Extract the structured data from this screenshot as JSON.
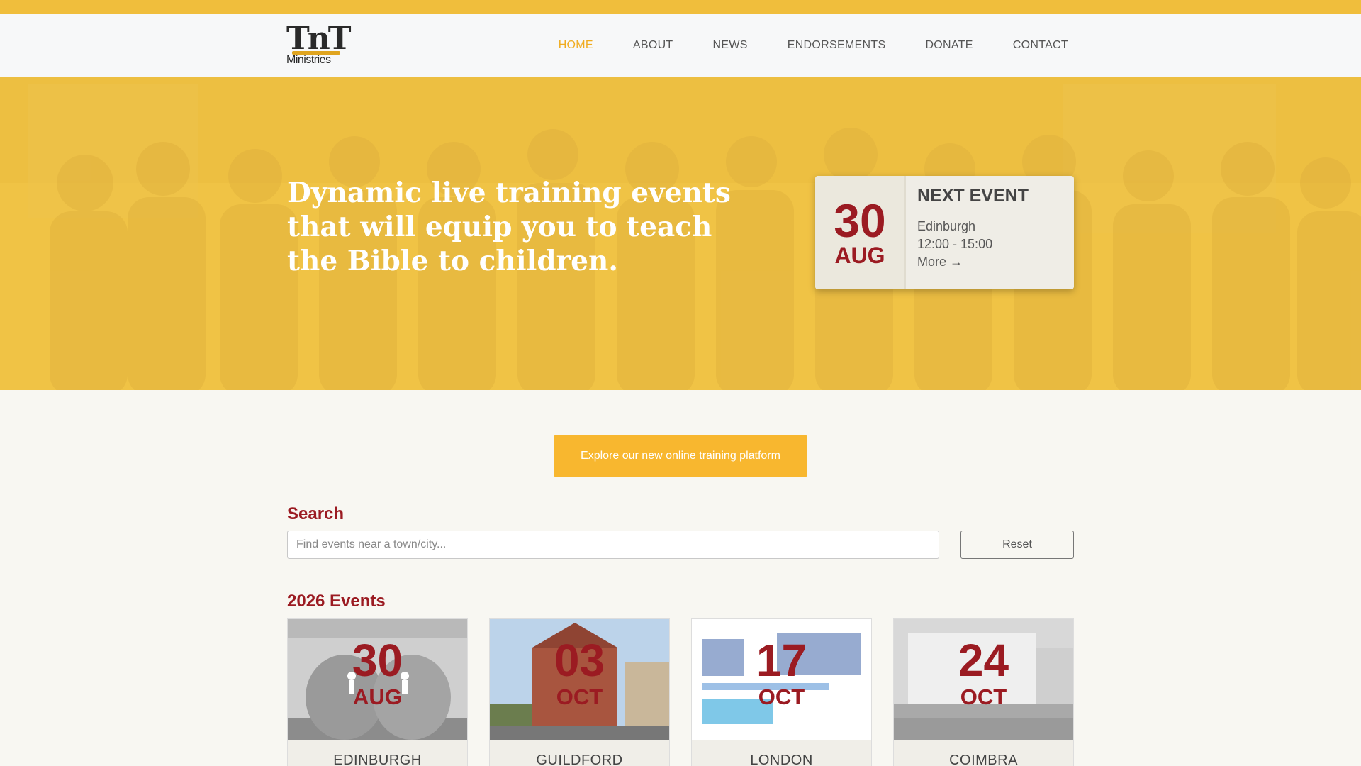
{
  "brand": {
    "logo_top": "TnT",
    "logo_bottom": "Ministries"
  },
  "nav": {
    "items": [
      "HOME",
      "ABOUT",
      "NEWS",
      "ENDORSEMENTS",
      "DONATE",
      "CONTACT"
    ],
    "active": "HOME"
  },
  "hero": {
    "title": "Dynamic live training events that will equip you to teach the Bible to children."
  },
  "next_event": {
    "heading": "NEXT EVENT",
    "day": "30",
    "month": "AUG",
    "location": "Edinburgh",
    "time": "12:00 - 15:00",
    "more": "More →"
  },
  "cta": {
    "label": "Explore our new online training platform"
  },
  "search": {
    "title": "Search",
    "placeholder": "Find events near a town/city...",
    "reset_label": "Reset"
  },
  "events": {
    "title": "2026 Events",
    "items": [
      {
        "day": "30",
        "month": "AUG",
        "city": "EDINBURGH"
      },
      {
        "day": "03",
        "month": "OCT",
        "city": "GUILDFORD"
      },
      {
        "day": "17",
        "month": "OCT",
        "city": "LONDON"
      },
      {
        "day": "24",
        "month": "OCT",
        "city": "COIMBRA"
      }
    ]
  },
  "colors": {
    "accent_yellow": "#f8b72f",
    "hero_overlay": "#f0c445",
    "date_red": "#9b1b22",
    "nav_active": "#f0ab1e"
  }
}
